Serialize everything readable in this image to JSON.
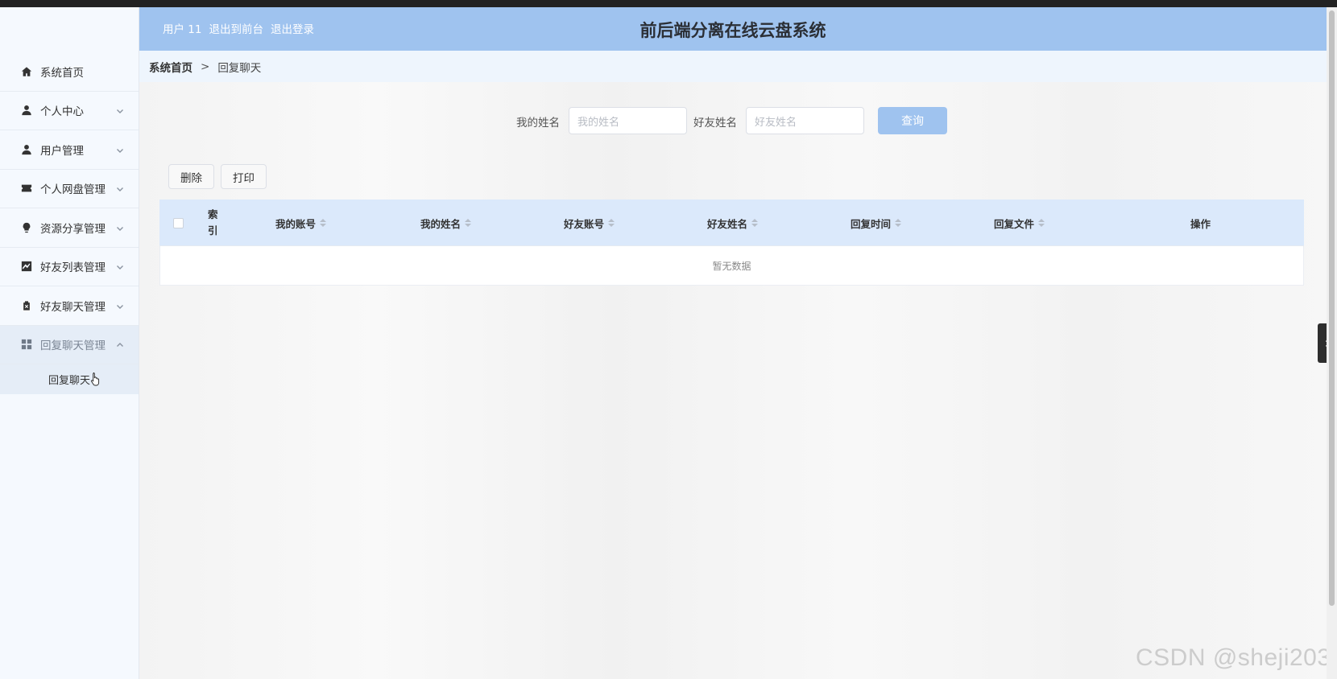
{
  "header": {
    "user": "用户 11",
    "to_front": "退出到前台",
    "logout": "退出登录",
    "title": "前后端分离在线云盘系统"
  },
  "sidebar": {
    "items": [
      {
        "label": "系统首页",
        "icon": "home-icon"
      },
      {
        "label": "个人中心",
        "icon": "user-icon"
      },
      {
        "label": "用户管理",
        "icon": "user-icon"
      },
      {
        "label": "个人网盘管理",
        "icon": "ticket-icon"
      },
      {
        "label": "资源分享管理",
        "icon": "bulb-icon"
      },
      {
        "label": "好友列表管理",
        "icon": "chart-icon"
      },
      {
        "label": "好友聊天管理",
        "icon": "clipboard-icon"
      },
      {
        "label": "回复聊天管理",
        "icon": "grid-icon"
      }
    ],
    "subitem": "回复聊天"
  },
  "breadcrumb": {
    "home": "系统首页",
    "sep": ">",
    "current": "回复聊天"
  },
  "search": {
    "my_name_label": "我的姓名",
    "my_name_placeholder": "我的姓名",
    "friend_name_label": "好友姓名",
    "friend_name_placeholder": "好友姓名",
    "query_button": "查询"
  },
  "actions": {
    "delete": "删除",
    "print": "打印"
  },
  "table": {
    "columns": {
      "index": "索引",
      "my_account": "我的账号",
      "my_name": "我的姓名",
      "friend_account": "好友账号",
      "friend_name": "好友姓名",
      "reply_time": "回复时间",
      "reply_file": "回复文件",
      "operation": "操作"
    },
    "empty_text": "暂无数据"
  },
  "watermark": "CSDN @sheji203",
  "colors": {
    "header_bg": "#9fc3ef",
    "table_header_bg": "#dbe9fb",
    "sidebar_bg": "#f5f9fe"
  }
}
